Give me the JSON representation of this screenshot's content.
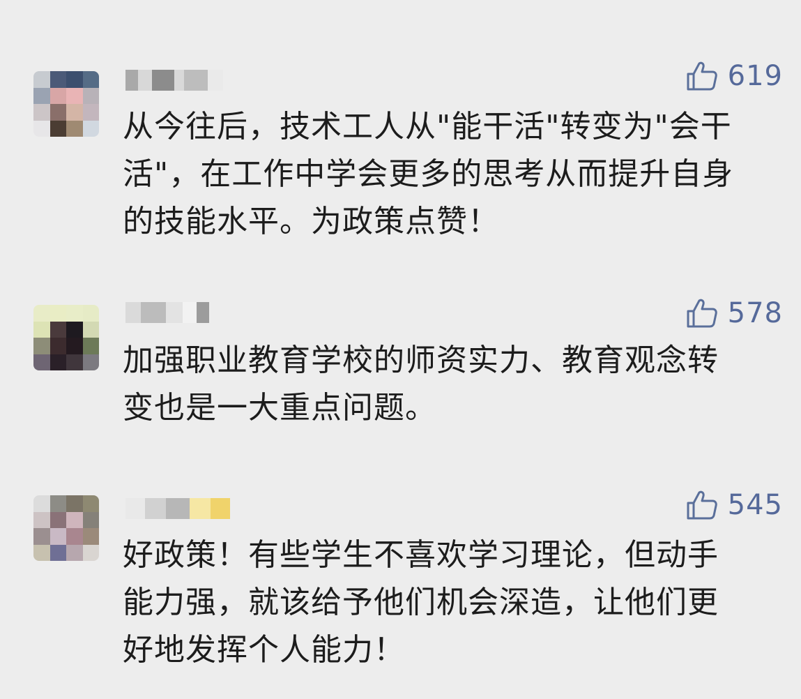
{
  "comments": [
    {
      "likes": "619",
      "text": "从今往后，技术工人从\"能干活\"转变为\"会干\n活\"，在工作中学会更多的思考从而提升自身\n的技能水平。为政策点赞！",
      "avatar_colors": [
        "#c7cbd0",
        "#4b5a78",
        "#3c4f6e",
        "#556c86",
        "#9aa3b2",
        "#d8a6a6",
        "#e9b4b5",
        "#b8b2b8",
        "#ccc5c7",
        "#8a6f6a",
        "#d4b5a6",
        "#c3b6bd",
        "#e7e6e8",
        "#4b3d33",
        "#9f8a72",
        "#d1d8e0"
      ],
      "username_colors": [
        "#a9a9a9",
        "#d8d8d8",
        "#8c8c8c",
        "#d9d9d9",
        "#bdbdbd",
        "#eaeaea"
      ]
    },
    {
      "likes": "578",
      "text": "加强职业教育学校的师资实力、教育观念转\n变也是一大重点问题。",
      "avatar_colors": [
        "#e8ecc7",
        "#e9edc5",
        "#e8edc8",
        "#e6ebc6",
        "#dde3b5",
        "#4a3a3c",
        "#1e1a20",
        "#d3d9b3",
        "#8d8d78",
        "#3c2b2e",
        "#241a20",
        "#6d7a58",
        "#6e6573",
        "#2a2028",
        "#40363c",
        "#7c7a80"
      ],
      "username_colors": [
        "#dadada",
        "#bcbcbc",
        "#e3e3e3",
        "#f2f2f2",
        "#9c9c9c"
      ]
    },
    {
      "likes": "545",
      "text": "好政策！有些学生不喜欢学习理论，但动手\n能力强，就该给予他们机会深造，让他们更\n好地发挥个人能力！",
      "avatar_colors": [
        "#dcdcdc",
        "#8d8c86",
        "#7b7466",
        "#8e8972",
        "#cdc3c4",
        "#8a7278",
        "#cfb5bc",
        "#858179",
        "#9b8f90",
        "#c9b9c5",
        "#a9868f",
        "#9b8a7a",
        "#c7c1af",
        "#6f6f95",
        "#b7a7ae",
        "#d9d5d1"
      ],
      "username_colors": [
        "#e9e9e9",
        "#d1d1d1",
        "#b7b7b7",
        "#f6e7a4",
        "#f0d36b"
      ]
    }
  ]
}
